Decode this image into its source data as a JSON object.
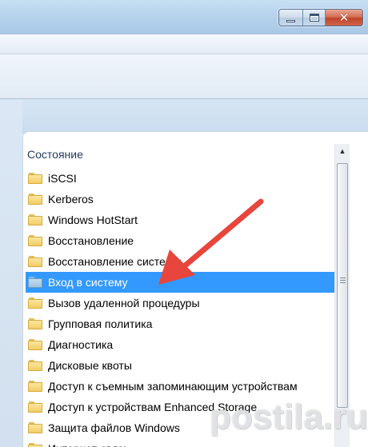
{
  "window": {
    "caption_buttons": {
      "minimize_icon": "minimize-icon",
      "maximize_icon": "maximize-icon",
      "close_icon": "close-icon",
      "close_glyph": "✕"
    }
  },
  "list": {
    "column_header": "Состояние",
    "items": [
      {
        "label": "iSCSI",
        "selected": false
      },
      {
        "label": "Kerberos",
        "selected": false
      },
      {
        "label": "Windows HotStart",
        "selected": false
      },
      {
        "label": "Восстановление",
        "selected": false
      },
      {
        "label": "Восстановление системы",
        "selected": false
      },
      {
        "label": "Вход в систему",
        "selected": true
      },
      {
        "label": "Вызов удаленной процедуры",
        "selected": false
      },
      {
        "label": "Групповая политика",
        "selected": false
      },
      {
        "label": "Диагностика",
        "selected": false
      },
      {
        "label": "Дисковые квоты",
        "selected": false
      },
      {
        "label": "Доступ к съемным запоминающим устройствам",
        "selected": false
      },
      {
        "label": "Доступ к устройствам Enhanced Storage",
        "selected": false
      },
      {
        "label": "Защита файлов Windows",
        "selected": false
      },
      {
        "label": "Интернет-связь",
        "selected": false
      }
    ]
  },
  "scrollbar": {
    "up_glyph": "▲"
  },
  "annotation": {
    "arrow_color": "#e8453c"
  },
  "colors": {
    "selection": "#3399ff",
    "folder": "#f2cd64"
  },
  "watermark": {
    "text": "postila.ru"
  }
}
